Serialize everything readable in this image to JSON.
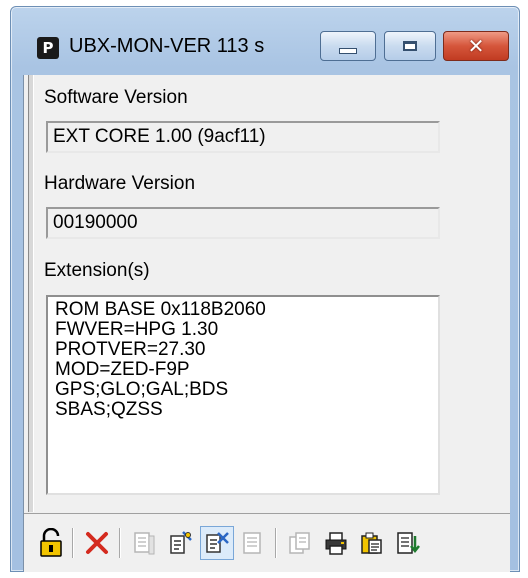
{
  "window": {
    "title": "UBX-MON-VER 113 s",
    "icon_letter": "P",
    "min_icon": "minimize-icon",
    "max_icon": "maximize-icon",
    "close_icon": "close-icon",
    "close_glyph": "✕"
  },
  "software": {
    "label": "Software Version",
    "value": "EXT CORE 1.00 (9acf11)"
  },
  "hardware": {
    "label": "Hardware Version",
    "value": "00190000"
  },
  "extensions": {
    "label": "Extension(s)",
    "lines": [
      "ROM BASE 0x118B2060",
      "FWVER=HPG 1.30",
      "PROTVER=27.30",
      "MOD=ZED-F9P",
      "GPS;GLO;GAL;BDS",
      "SBAS;QZSS"
    ]
  },
  "toolbar": {
    "items": [
      {
        "icon": "lock-open-icon",
        "enabled": true
      },
      {
        "icon": "delete-icon",
        "enabled": true
      },
      {
        "icon": "copy-text-icon",
        "enabled": false
      },
      {
        "icon": "edit-settings-icon",
        "enabled": true
      },
      {
        "icon": "auto-poll-icon",
        "enabled": true,
        "pressed": true
      },
      {
        "icon": "document-icon",
        "enabled": false
      },
      {
        "icon": "copy-icon",
        "enabled": false
      },
      {
        "icon": "print-icon",
        "enabled": true
      },
      {
        "icon": "clipboard-icon",
        "enabled": true
      },
      {
        "icon": "export-icon",
        "enabled": true
      }
    ]
  },
  "colors": {
    "titlebar": "#bcd3ec",
    "close_button": "#c13b22",
    "delete_icon": "#d42a1e",
    "lock_icon": "#e2b400",
    "client_bg": "#f0f0f0"
  }
}
